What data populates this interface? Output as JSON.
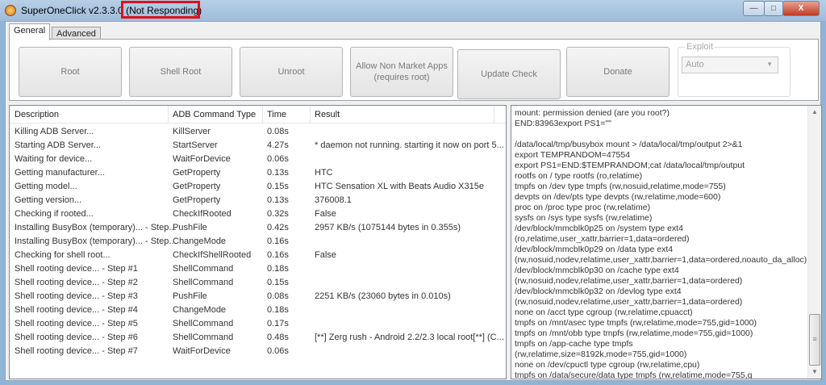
{
  "window": {
    "title": "SuperOneClick v2.3.3.0",
    "status": "(Not Responding)",
    "minimize": "—",
    "maximize": "□",
    "close": "X"
  },
  "tabs": [
    {
      "label": "General"
    },
    {
      "label": "Advanced"
    }
  ],
  "buttons": [
    {
      "label": "Root"
    },
    {
      "label": "Shell Root"
    },
    {
      "label": "Unroot"
    },
    {
      "label": "Allow Non Market Apps",
      "sub": "(requires root)"
    },
    {
      "label": "Update Check"
    },
    {
      "label": "Donate"
    }
  ],
  "exploit": {
    "label": "Exploit",
    "value": "Auto"
  },
  "table": {
    "columns": [
      "Description",
      "ADB Command Type",
      "Time",
      "Result"
    ],
    "rows": [
      [
        "Killing ADB Server...",
        "KillServer",
        "0.08s",
        ""
      ],
      [
        "Starting ADB Server...",
        "StartServer",
        "4.27s",
        "* daemon not running. starting it now on port 5..."
      ],
      [
        "Waiting for device...",
        "WaitForDevice",
        "0.06s",
        ""
      ],
      [
        "Getting manufacturer...",
        "GetProperty",
        "0.13s",
        "HTC"
      ],
      [
        "Getting model...",
        "GetProperty",
        "0.15s",
        "HTC Sensation XL with Beats Audio X315e"
      ],
      [
        "Getting version...",
        "GetProperty",
        "0.13s",
        "376008.1"
      ],
      [
        "Checking if rooted...",
        "CheckIfRooted",
        "0.32s",
        "False"
      ],
      [
        "Installing BusyBox (temporary)... - Step...",
        "PushFile",
        "0.42s",
        "2957 KB/s (1075144 bytes in 0.355s)"
      ],
      [
        "Installing BusyBox (temporary)... - Step...",
        "ChangeMode",
        "0.16s",
        ""
      ],
      [
        "Checking for shell root...",
        "CheckIfShellRooted",
        "0.16s",
        "False"
      ],
      [
        "Shell rooting device... - Step #1",
        "ShellCommand",
        "0.18s",
        ""
      ],
      [
        "Shell rooting device... - Step #2",
        "ShellCommand",
        "0.15s",
        ""
      ],
      [
        "Shell rooting device... - Step #3",
        "PushFile",
        "0.08s",
        "2251 KB/s (23060 bytes in 0.010s)"
      ],
      [
        "Shell rooting device... - Step #4",
        "ChangeMode",
        "0.18s",
        ""
      ],
      [
        "Shell rooting device... - Step #5",
        "ShellCommand",
        "0.17s",
        ""
      ],
      [
        "Shell rooting device... - Step #6",
        "ShellCommand",
        "0.48s",
        "[**] Zerg rush - Android 2.2/2.3 local root[**] (C..."
      ],
      [
        "Shell rooting device... - Step #7",
        "WaitForDevice",
        "0.06s",
        ""
      ]
    ]
  },
  "log": "mount: permission denied (are you root?)\nEND:83963export PS1=\"\"\n\n/data/local/tmp/busybox mount > /data/local/tmp/output 2>&1\nexport TEMPRANDOM=47554\nexport PS1=END:$TEMPRANDOM;cat /data/local/tmp/output\nrootfs on / type rootfs (ro,relatime)\ntmpfs on /dev type tmpfs (rw,nosuid,relatime,mode=755)\ndevpts on /dev/pts type devpts (rw,relatime,mode=600)\nproc on /proc type proc (rw,relatime)\nsysfs on /sys type sysfs (rw,relatime)\n/dev/block/mmcblk0p25 on /system type ext4\n(ro,relatime,user_xattr,barrier=1,data=ordered)\n/dev/block/mmcblk0p29 on /data type ext4\n(rw,nosuid,nodev,relatime,user_xattr,barrier=1,data=ordered,noauto_da_alloc)\n/dev/block/mmcblk0p30 on /cache type ext4\n(rw,nosuid,nodev,relatime,user_xattr,barrier=1,data=ordered)\n/dev/block/mmcblk0p32 on /devlog type ext4\n(rw,nosuid,nodev,relatime,user_xattr,barrier=1,data=ordered)\nnone on /acct type cgroup (rw,relatime,cpuacct)\ntmpfs on /mnt/asec type tmpfs (rw,relatime,mode=755,gid=1000)\ntmpfs on /mnt/obb type tmpfs (rw,relatime,mode=755,gid=1000)\ntmpfs on /app-cache type tmpfs\n(rw,relatime,size=8192k,mode=755,gid=1000)\nnone on /dev/cpuctl type cgroup (rw,relatime,cpu)\ntmpfs on /data/secure/data type tmpfs (rw,relatime,mode=755,g"
}
